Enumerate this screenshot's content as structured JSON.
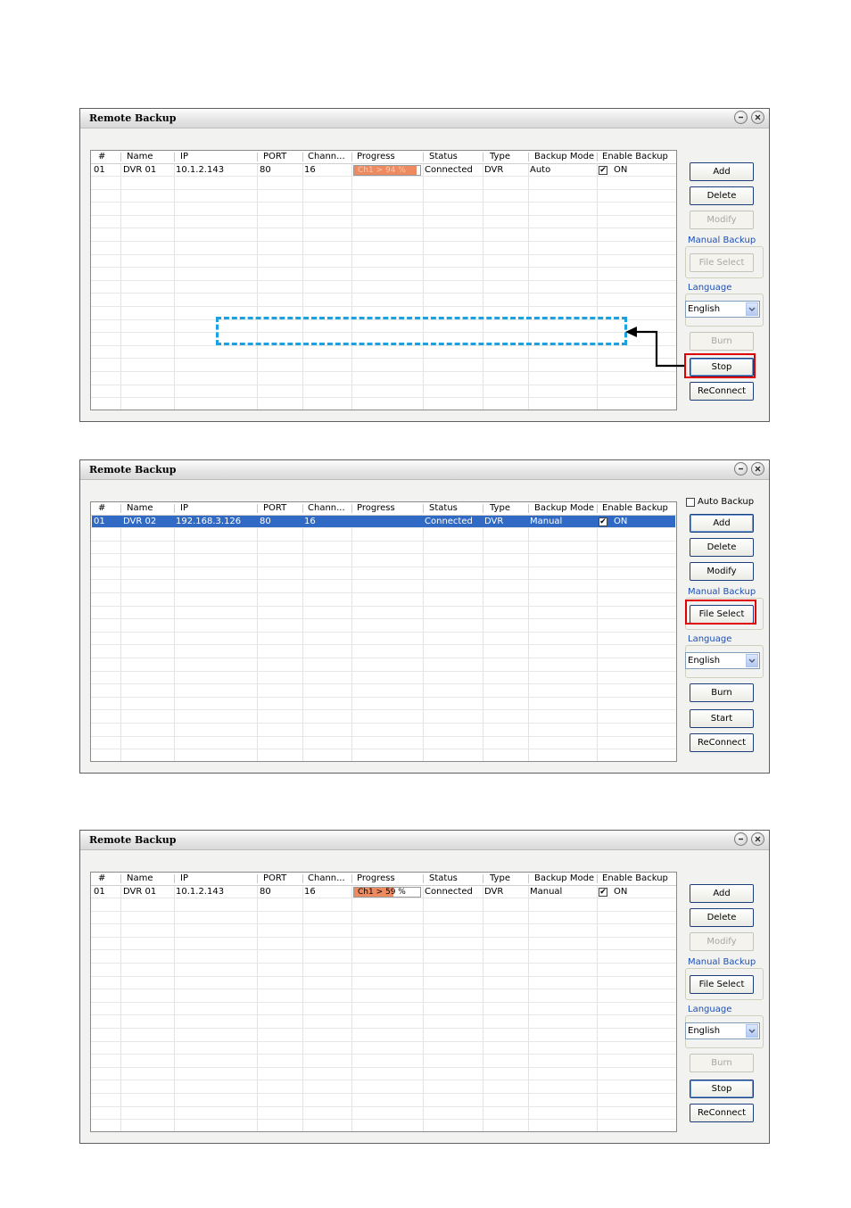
{
  "columns": [
    "#",
    "Name",
    "IP",
    "PORT",
    "Chann...",
    "Progress",
    "Status",
    "Type",
    "Backup Mode",
    "Enable Backup"
  ],
  "windows": [
    {
      "title": "Remote Backup",
      "row": {
        "num": "01",
        "name": "DVR 01",
        "ip": "10.1.2.143",
        "port": "80",
        "channel": "16",
        "progress_text": "Ch1 > 94 %",
        "progress_value": 0.94,
        "status": "Connected",
        "type": "DVR",
        "mode": "Auto",
        "enable": "ON"
      },
      "buttons": {
        "add": "Add",
        "delete": "Delete",
        "modify": "Modify",
        "file_select": "File Select",
        "burn": "Burn",
        "action": "Stop",
        "reconnect": "ReConnect"
      },
      "manual_backup_label": "Manual Backup",
      "language_label": "Language",
      "language_value": "English"
    },
    {
      "title": "Remote Backup",
      "auto_backup_label": "Auto Backup",
      "row": {
        "num": "01",
        "name": "DVR 02",
        "ip": "192.168.3.126",
        "port": "80",
        "channel": "16",
        "progress_text": "",
        "status": "Connected",
        "type": "DVR",
        "mode": "Manual",
        "enable": "ON"
      },
      "buttons": {
        "add": "Add",
        "delete": "Delete",
        "modify": "Modify",
        "file_select": "File Select",
        "burn": "Burn",
        "action": "Start",
        "reconnect": "ReConnect"
      },
      "manual_backup_label": "Manual Backup",
      "language_label": "Language",
      "language_value": "English"
    },
    {
      "title": "Remote Backup",
      "row": {
        "num": "01",
        "name": "DVR 01",
        "ip": "10.1.2.143",
        "port": "80",
        "channel": "16",
        "progress_text": "Ch1 > 59 %",
        "progress_value": 0.59,
        "status": "Connected",
        "type": "DVR",
        "mode": "Manual",
        "enable": "ON"
      },
      "buttons": {
        "add": "Add",
        "delete": "Delete",
        "modify": "Modify",
        "file_select": "File Select",
        "burn": "Burn",
        "action": "Stop",
        "reconnect": "ReConnect"
      },
      "manual_backup_label": "Manual Backup",
      "language_label": "Language",
      "language_value": "English"
    }
  ],
  "colors": {
    "progress_fill": "#ee8a60",
    "selection": "#316ac5",
    "highlight": "#e00000",
    "dashed": "#1ba0e0",
    "group_label": "#1d4fb5"
  }
}
